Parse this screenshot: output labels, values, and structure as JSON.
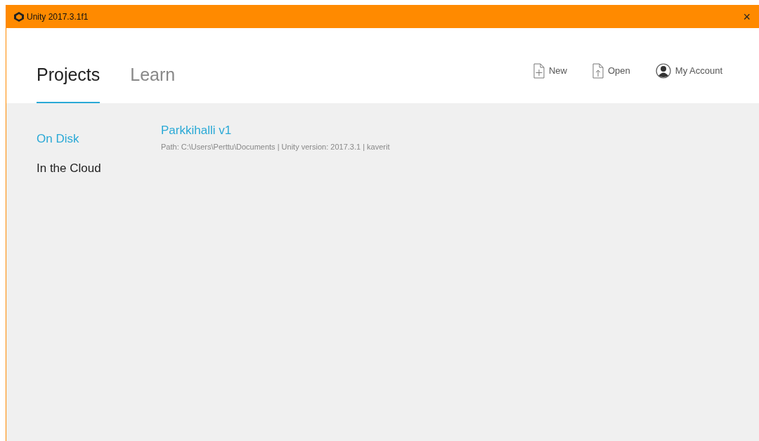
{
  "window": {
    "title": "Unity 2017.3.1f1",
    "close": "×"
  },
  "tabs": [
    {
      "label": "Projects",
      "selected": true
    },
    {
      "label": "Learn",
      "selected": false
    }
  ],
  "actions": [
    {
      "kind": "new",
      "label": "New"
    },
    {
      "kind": "open",
      "label": "Open"
    },
    {
      "kind": "account",
      "label": "My Account"
    }
  ],
  "sidebar": {
    "items": [
      {
        "label": "On Disk",
        "selected": true
      },
      {
        "label": "In the Cloud",
        "selected": false
      }
    ]
  },
  "projects": [
    {
      "name": "Parkkihalli v1",
      "details": "Path: C:\\Users\\Perttu\\Documents | Unity version: 2017.3.1 | kaverit"
    }
  ]
}
